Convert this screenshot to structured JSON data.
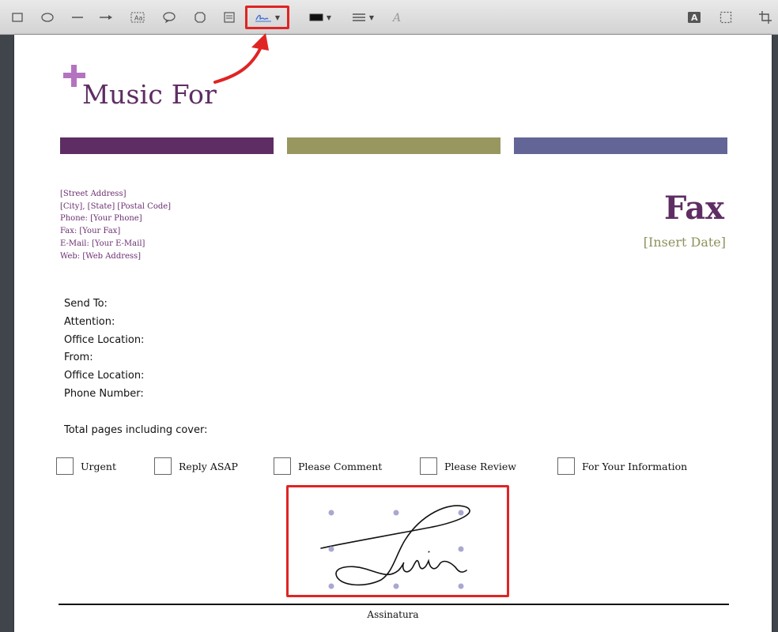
{
  "colors": {
    "purple": "#5e2d63",
    "olive": "#98975f",
    "slate": "#636597",
    "highlight_red": "#e02424"
  },
  "toolbar": {
    "tools": [
      {
        "name": "rectangle-tool",
        "icon": "rectangle-icon"
      },
      {
        "name": "oval-tool",
        "icon": "oval-icon"
      },
      {
        "name": "line-tool",
        "icon": "line-icon"
      },
      {
        "name": "arrow-tool",
        "icon": "arrow-icon"
      },
      {
        "name": "text-tool",
        "icon": "text-box-icon"
      },
      {
        "name": "speech-bubble-tool",
        "icon": "speech-bubble-icon"
      },
      {
        "name": "shape-tool",
        "icon": "octagon-icon"
      },
      {
        "name": "note-tool",
        "icon": "note-icon"
      },
      {
        "name": "signature-tool",
        "icon": "signature-icon"
      },
      {
        "name": "border-color-tool",
        "icon": "border-color-icon"
      },
      {
        "name": "line-style-tool",
        "icon": "line-style-icon"
      },
      {
        "name": "text-style-tool",
        "icon": "font-icon"
      },
      {
        "name": "text-style-button",
        "icon": "text-style-icon"
      },
      {
        "name": "selection-tool",
        "icon": "selection-icon"
      },
      {
        "name": "crop-tool",
        "icon": "crop-icon"
      }
    ]
  },
  "document": {
    "logo_text": "Music For",
    "address": [
      "[Street Address]",
      "[City], [State] [Postal Code]",
      "Phone: [Your Phone]",
      "Fax: [Your Fax]",
      "E-Mail: [Your E-Mail]",
      "Web: [Web Address]"
    ],
    "title": "Fax",
    "date": "[Insert Date]",
    "fields": [
      "Send To:",
      "Attention:",
      "Office Location:",
      "From:",
      "Office Location:",
      "Phone Number:"
    ],
    "total_pages": "Total pages including cover:",
    "checkboxes": [
      "Urgent",
      "Reply ASAP",
      "Please Comment",
      "Please Review",
      "For Your Information"
    ],
    "signature_label": "Assinatura"
  }
}
